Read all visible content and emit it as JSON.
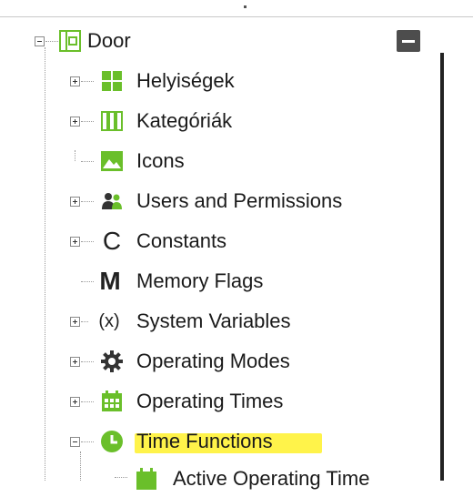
{
  "tree": {
    "root": {
      "label": "Door",
      "icon": "door-module-icon"
    },
    "items": [
      {
        "label": "Helyiségek",
        "icon": "rooms-grid-icon"
      },
      {
        "label": "Kategóriák",
        "icon": "categories-icon"
      },
      {
        "label": "Icons",
        "icon": "image-icon"
      },
      {
        "label": "Users and Permissions",
        "icon": "users-icon"
      },
      {
        "label": "Constants",
        "icon": "constant-icon"
      },
      {
        "label": "Memory Flags",
        "icon": "memory-flag-icon"
      },
      {
        "label": "System Variables",
        "icon": "variable-icon"
      },
      {
        "label": "Operating Modes",
        "icon": "gear-icon"
      },
      {
        "label": "Operating Times",
        "icon": "calendar-icon"
      },
      {
        "label": "Time Functions",
        "icon": "clock-icon"
      }
    ],
    "child": {
      "label": "Active Operating Time",
      "icon": "calendar-icon"
    }
  },
  "colors": {
    "accent_green": "#6abf2a",
    "highlight": "#fff34a",
    "dark": "#4d4d4d"
  }
}
